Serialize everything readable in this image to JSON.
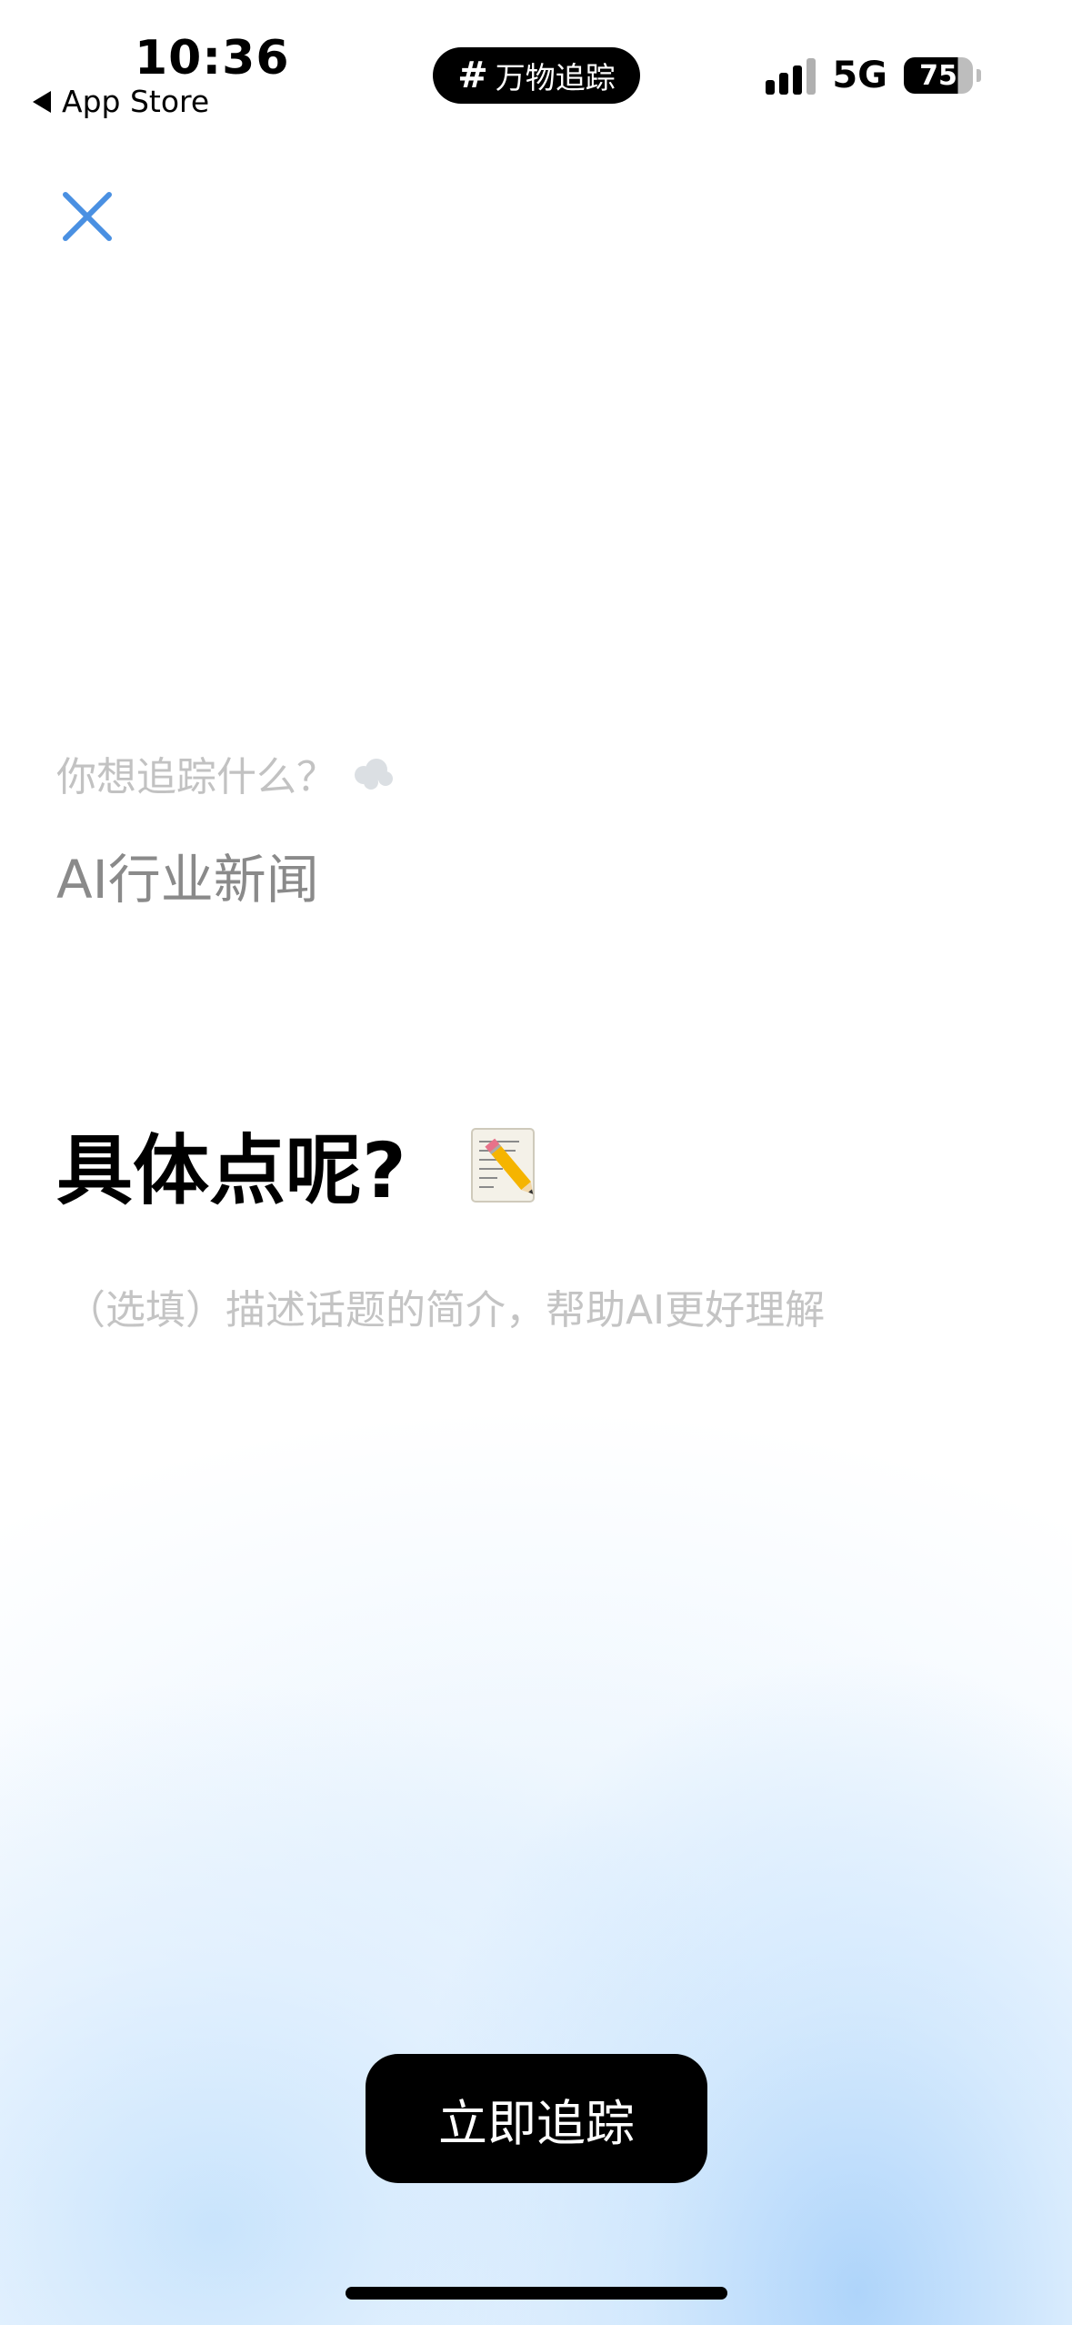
{
  "status_bar": {
    "time": "10:36",
    "back_label": "App Store",
    "island_label": "万物追踪",
    "network": "5G",
    "battery": "75"
  },
  "form": {
    "question_label": "你想追踪什么？",
    "topic_value": "AI行业新闻",
    "detail_heading": "具体点呢?",
    "description_placeholder": "（选填）描述话题的简介，帮助AI更好理解"
  },
  "actions": {
    "track_label": "立即追踪"
  },
  "colors": {
    "close_icon": "#4a90e2",
    "button_bg": "#000000",
    "gradient_blue": "#b3d8fa"
  }
}
